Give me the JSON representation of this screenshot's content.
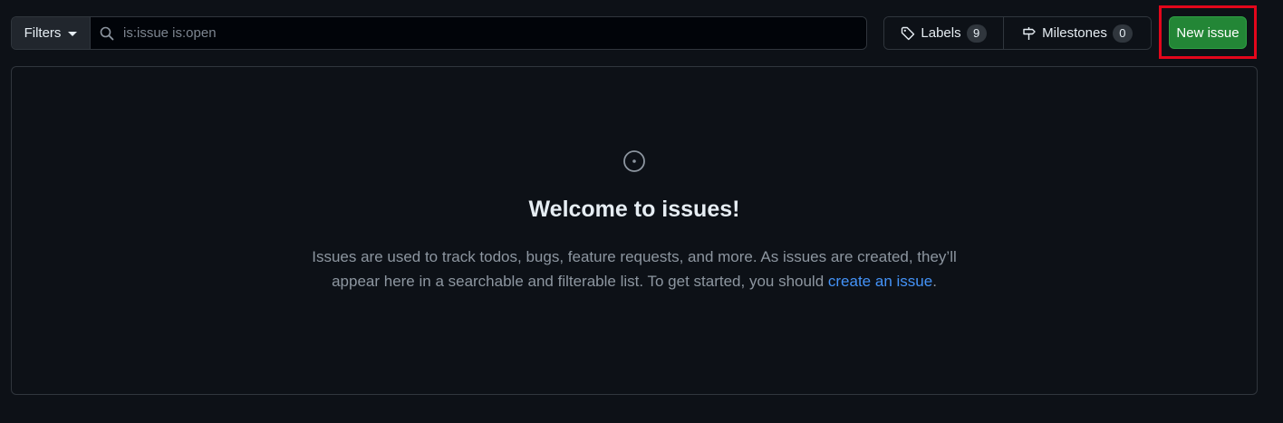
{
  "toolbar": {
    "filters_label": "Filters",
    "search_value": "is:issue is:open",
    "labels_label": "Labels",
    "labels_count": "9",
    "milestones_label": "Milestones",
    "milestones_count": "0",
    "new_issue_label": "New issue"
  },
  "blankslate": {
    "heading": "Welcome to issues!",
    "description_pre": "Issues are used to track todos, bugs, feature requests, and more. As issues are created, they’ll appear here in a searchable and filterable list. To get started, you should ",
    "link_text": "create an issue",
    "description_post": "."
  },
  "icons": {
    "search": "search-icon",
    "tag": "tag-icon",
    "milestone": "milestone-icon",
    "issue": "issue-opened-icon"
  },
  "colors": {
    "background": "#0d1117",
    "primary_button": "#238636",
    "link": "#4493f8",
    "highlight": "#e3061b"
  }
}
